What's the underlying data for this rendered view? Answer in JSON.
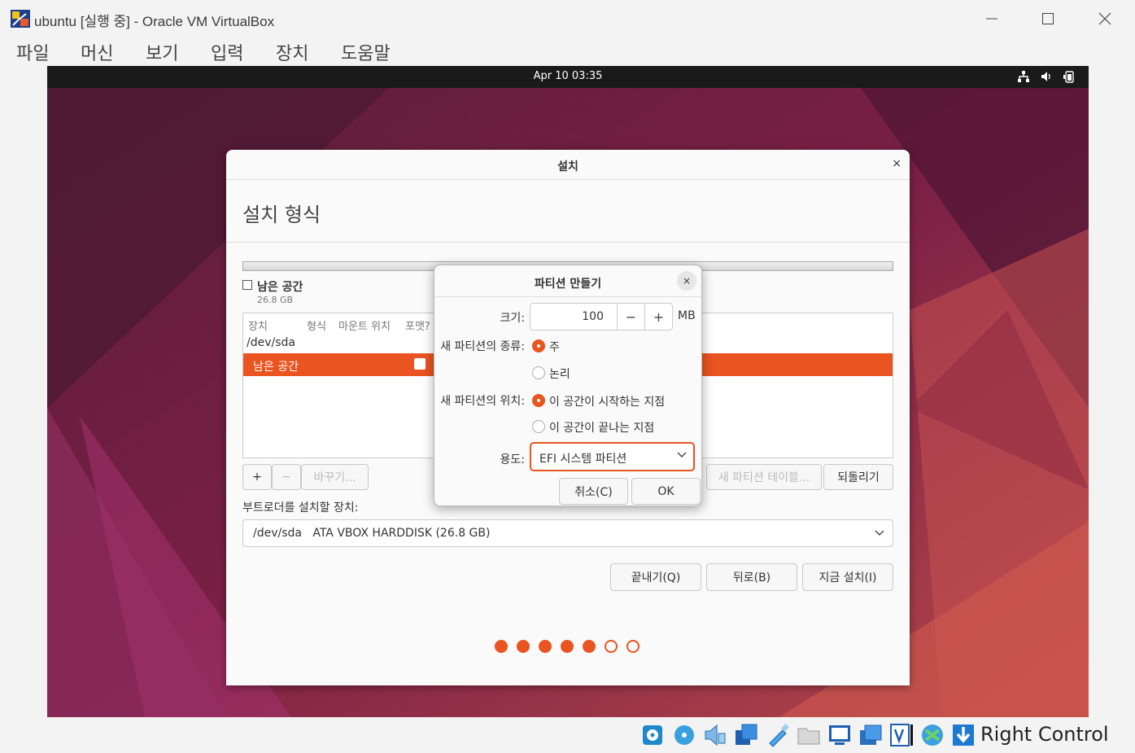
{
  "window": {
    "title": "ubuntu [실행 중] - Oracle VM VirtualBox",
    "controls": {
      "minimize": "—",
      "maximize": "☐",
      "close": "✕"
    }
  },
  "menu": [
    "파일",
    "머신",
    "보기",
    "입력",
    "장치",
    "도움말"
  ],
  "vm_topbar": {
    "clock": "Apr 10  03:35"
  },
  "installer": {
    "title": "설치",
    "close": "×",
    "heading": "설치 형식",
    "free_space": {
      "label": "남은 공간",
      "size": "26.8 GB"
    },
    "table": {
      "columns": [
        "장치",
        "형식",
        "마운트 위치",
        "포맷?"
      ],
      "rows": [
        {
          "device": "/dev/sda"
        },
        {
          "device": "남은 공간",
          "selected": true
        }
      ]
    },
    "buttons": {
      "add": "+",
      "remove": "−",
      "change": "바꾸기...",
      "new_table": "새 파티션 테이블...",
      "revert": "되돌리기"
    },
    "bootloader": {
      "label": "부트로더를 설치할 장치:",
      "device": "/dev/sda",
      "description": "ATA VBOX HARDDISK (26.8 GB)"
    },
    "nav": {
      "quit": "끝내기(Q)",
      "back": "뒤로(B)",
      "install": "지금 설치(I)"
    },
    "progress": {
      "total": 7,
      "completed": 5
    }
  },
  "partition_dialog": {
    "title": "파티션 만들기",
    "close": "×",
    "size_label": "크기:",
    "size_value": "100",
    "decrement": "−",
    "increment": "+",
    "unit": "MB",
    "type_label": "새 파티션의 종류:",
    "type_options": [
      "주",
      "논리"
    ],
    "type_selected": "주",
    "location_label": "새 파티션의 위치:",
    "location_options": [
      "이 공간이 시작하는 지점",
      "이 공간이 끝나는 지점"
    ],
    "location_selected": "이 공간이 시작하는 지점",
    "use_label": "용도:",
    "use_value": "EFI 시스템 파티션",
    "cancel": "취소(C)",
    "ok": "OK"
  },
  "statusbar": {
    "host_key": "Right Control"
  },
  "colors": {
    "accent": "#e95420",
    "topbar": "#1a1a1a"
  }
}
